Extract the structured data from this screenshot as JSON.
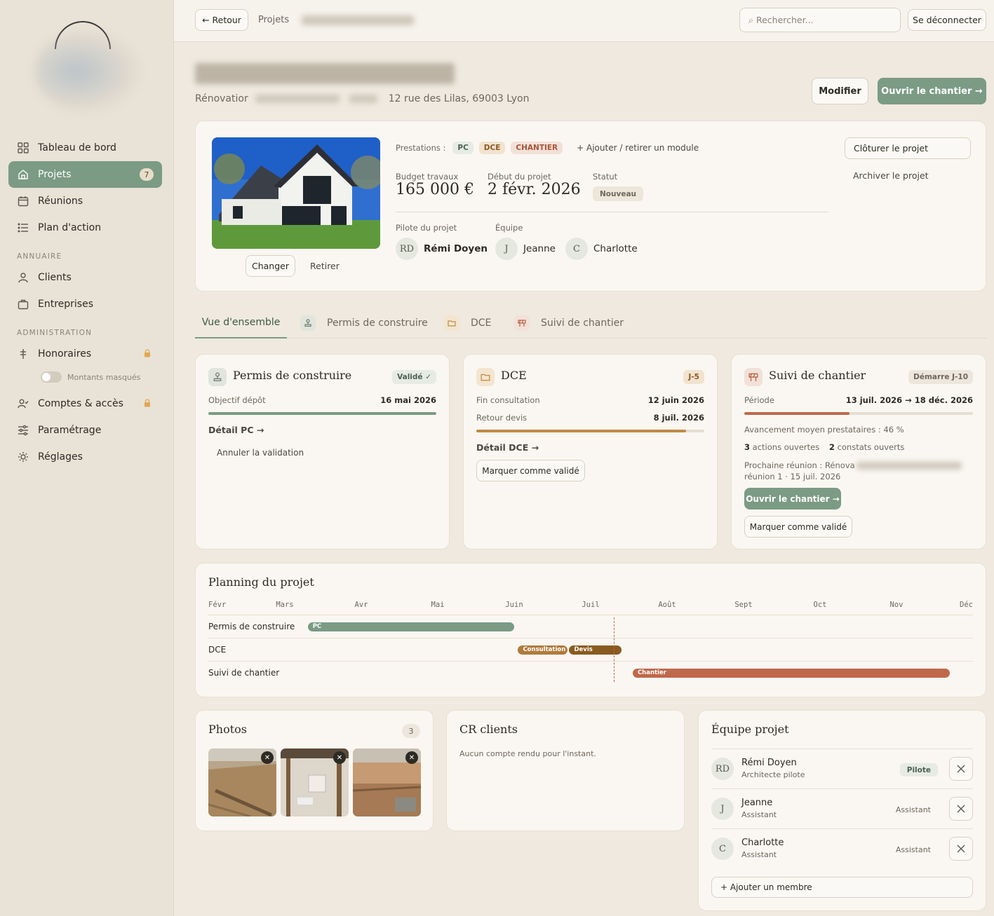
{
  "sidebar": {
    "items": [
      {
        "label": "Tableau de bord",
        "icon": "dashboard-icon"
      },
      {
        "label": "Projets",
        "icon": "home-icon",
        "count": "7"
      },
      {
        "label": "Réunions",
        "icon": "calendar-icon"
      },
      {
        "label": "Plan d'action",
        "icon": "list-icon"
      },
      {
        "label": "Clients",
        "icon": "user-icon"
      },
      {
        "label": "Entreprises",
        "icon": "briefcase-icon"
      },
      {
        "label": "Honoraires",
        "icon": "currency-icon"
      },
      {
        "label": "Comptes & accès",
        "icon": "user-check-icon"
      },
      {
        "label": "Paramétrage",
        "icon": "sliders-icon"
      },
      {
        "label": "Réglages",
        "icon": "sun-gear-icon"
      }
    ],
    "section_annuaire": "ANNUAIRE",
    "section_admin": "ADMINISTRATION",
    "toggle_label": "Montants masqués"
  },
  "topbar": {
    "back": "← Retour",
    "breadcrumb": "Projets",
    "search_placeholder": "⌕ Rechercher...",
    "logout": "Se déconnecter"
  },
  "header": {
    "subtitle_prefix": "Rénovatior",
    "address": "12 rue des Lilas, 69003 Lyon",
    "edit": "Modifier",
    "open_site": "Ouvrir le chantier →"
  },
  "project": {
    "change_photo": "Changer",
    "remove_photo": "Retirer",
    "prestations_label": "Prestations :",
    "prestations": [
      "PC",
      "DCE",
      "CHANTIER"
    ],
    "add_module": "+ Ajouter / retirer un module",
    "budget_label": "Budget travaux",
    "budget_value": "165 000 €",
    "start_label": "Début du projet",
    "start_value": "2 févr. 2026",
    "status_label": "Statut",
    "status_value": "Nouveau",
    "pilot_label": "Pilote du projet",
    "pilot_initials": "RD",
    "pilot_name": "Rémi Doyen",
    "team_label": "Équipe",
    "team": [
      {
        "initial": "J",
        "name": "Jeanne"
      },
      {
        "initial": "C",
        "name": "Charlotte"
      }
    ],
    "close": "Clôturer le projet",
    "archive": "Archiver le projet"
  },
  "tabs": [
    "Vue d'ensemble",
    "Permis de construire",
    "DCE",
    "Suivi de chantier"
  ],
  "pc_card": {
    "title": "Permis de construire",
    "badge": "Validé ✓",
    "objective_label": "Objectif dépôt",
    "objective_value": "16 mai 2026",
    "progress": 1.0,
    "detail": "Détail PC →",
    "cancel": "Annuler la validation"
  },
  "dce_card": {
    "title": "DCE",
    "badge": "J-5",
    "end_label": "Fin consultation",
    "end_value": "12 juin 2026",
    "return_label": "Retour devis",
    "return_value": "8 juil. 2026",
    "progress": 0.92,
    "detail": "Détail DCE →",
    "validate": "Marquer comme validé"
  },
  "site_card": {
    "title": "Suivi de chantier",
    "badge": "Démarre J-10",
    "period_label": "Période",
    "period_value": "13 juil. 2026 → 18 déc. 2026",
    "progress": 0.46,
    "avg_label": "Avancement moyen prestataires : 46 %",
    "actions_count": "3",
    "actions_label": "actions ouvertes",
    "findings_count": "2",
    "findings_label": "constats ouverts",
    "next_meeting_prefix": "Prochaine réunion : Rénova",
    "next_meeting_line2": "réunion 1 · 15 juil. 2026",
    "open_site": "Ouvrir le chantier →",
    "validate": "Marquer comme validé"
  },
  "planning": {
    "title": "Planning du projet",
    "months": [
      "Févr",
      "Mars",
      "Avr",
      "Mai",
      "Juin",
      "Juil",
      "Août",
      "Sept",
      "Oct",
      "Nov",
      "Déc"
    ],
    "rows": [
      "Permis de construire",
      "DCE",
      "Suivi de chantier"
    ],
    "bars": [
      {
        "row": 0,
        "label": "PC",
        "start": 1.3,
        "end": 4.0,
        "color": "#7b9b84"
      },
      {
        "row": 1,
        "label": "Consultation",
        "start": 4.05,
        "end": 4.7,
        "color": "#b07a3c"
      },
      {
        "row": 1,
        "label": "Devis",
        "start": 4.72,
        "end": 5.4,
        "color": "#8a5a20"
      },
      {
        "row": 2,
        "label": "Chantier",
        "start": 5.55,
        "end": 9.7,
        "color": "#c0684a"
      }
    ],
    "today": 5.3
  },
  "photos": {
    "title": "Photos",
    "count": "3"
  },
  "cr": {
    "title": "CR clients",
    "empty": "Aucun compte rendu pour l'instant."
  },
  "team_card": {
    "title": "Équipe projet",
    "members": [
      {
        "initials": "RD",
        "name": "Rémi Doyen",
        "role": "Architecte pilote",
        "tag": "Pilote"
      },
      {
        "initials": "J",
        "name": "Jeanne",
        "role": "Assistant",
        "tag": "Assistant"
      },
      {
        "initials": "C",
        "name": "Charlotte",
        "role": "Assistant",
        "tag": "Assistant"
      }
    ],
    "add": "+ Ajouter un membre"
  }
}
